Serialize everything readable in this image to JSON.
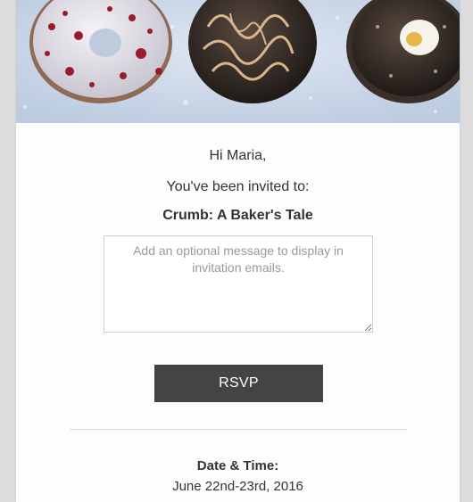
{
  "email": {
    "greeting": "Hi Maria,",
    "invited_text": "You've been invited to:",
    "event_title": "Crumb: A Baker's Tale",
    "message_placeholder": "Add an optional message to display in invitation emails.",
    "rsvp_label": "RSVP",
    "date_time_label": "Date & Time:",
    "date_time_value": "June 22nd-23rd, 2016"
  },
  "colors": {
    "page_background": "#dcdcdc",
    "card_background": "#fdfdfd",
    "button_background": "#444444",
    "button_text": "#ffffff",
    "text": "#333333",
    "hero_background": "#c9d6e8"
  }
}
